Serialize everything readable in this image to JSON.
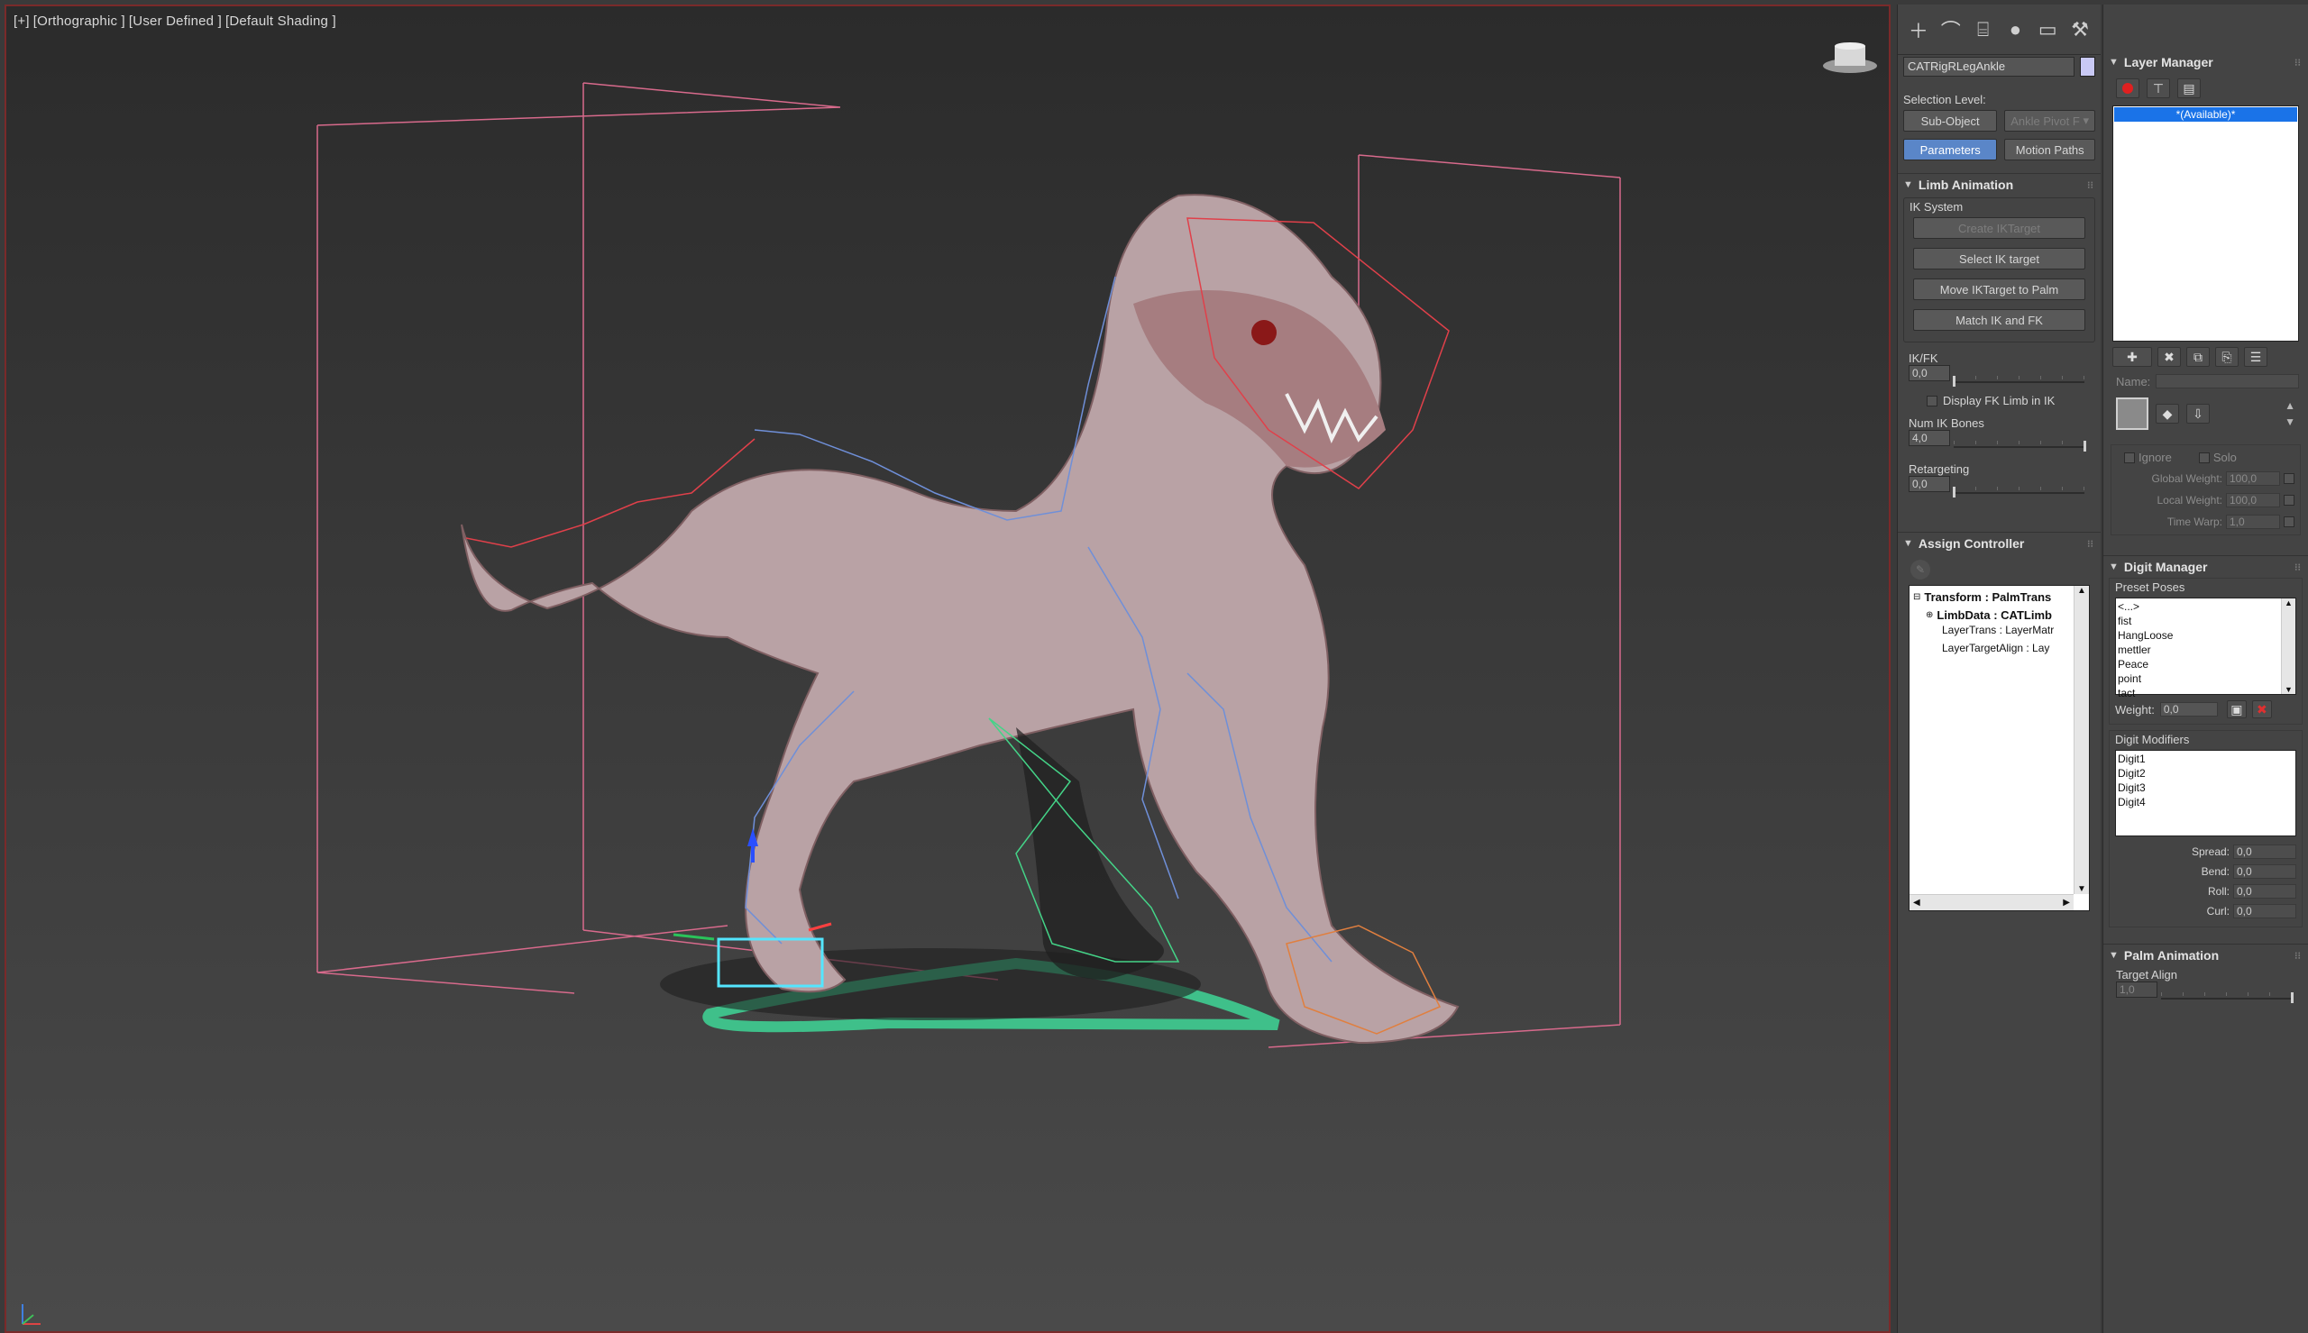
{
  "viewport": {
    "label_parts": [
      "[+]",
      "[Orthographic ]",
      "[User Defined ]",
      "[Default Shading ]"
    ]
  },
  "command_panel": {
    "tab_icons": [
      "create-icon",
      "modify-icon",
      "hierarchy-icon",
      "motion-icon",
      "display-icon",
      "utilities-icon"
    ],
    "object_name": "CATRigRLegAnkle",
    "object_color": "#c9c9f5",
    "selection_level_label": "Selection Level:",
    "sub_object_label": "Sub-Object",
    "pivot_select_value": "Ankle Pivot F",
    "parameters_label": "Parameters",
    "motion_paths_label": "Motion Paths",
    "limb_animation": {
      "title": "Limb Animation",
      "ik_system_label": "IK System",
      "create_iktarget": "Create IKTarget",
      "select_ik_target": "Select IK target",
      "move_iktarget": "Move IKTarget to Palm",
      "match_ik_fk": "Match IK and FK",
      "ikfk_label": "IK/FK",
      "ikfk_value": "0,0",
      "ikfk_fraction": 0.0,
      "display_fk_label": "Display FK Limb in IK",
      "num_ik_bones_label": "Num IK Bones",
      "num_ik_bones_value": "4,0",
      "num_ik_bones_fraction": 1.0,
      "retargeting_label": "Retargeting",
      "retargeting_value": "0,0",
      "retargeting_fraction": 0.0
    },
    "assign_controller": {
      "title": "Assign Controller",
      "tree": [
        {
          "text": "Transform : PalmTrans",
          "bold": true
        },
        {
          "text": "LimbData : CATLimb",
          "bold": true
        },
        {
          "text": "LayerTrans : LayerMatr",
          "bold": false
        },
        {
          "text": "LayerTargetAlign : Lay",
          "bold": false
        }
      ]
    }
  },
  "layer_manager": {
    "title": "Layer Manager",
    "available_item": "*(Available)*",
    "name_label": "Name:",
    "ignore_label": "Ignore",
    "solo_label": "Solo",
    "global_weight_label": "Global Weight:",
    "global_weight_value": "100,0",
    "local_weight_label": "Local Weight:",
    "local_weight_value": "100,0",
    "time_warp_label": "Time Warp:",
    "time_warp_value": "1,0"
  },
  "digit_manager": {
    "title": "Digit Manager",
    "preset_poses_label": "Preset Poses",
    "preset_poses": [
      "<...>",
      "fist",
      "HangLoose",
      "mettler",
      "Peace",
      "point",
      "tact"
    ],
    "weight_label": "Weight:",
    "weight_value": "0,0",
    "digit_modifiers_label": "Digit Modifiers",
    "digits": [
      "Digit1",
      "Digit2",
      "Digit3",
      "Digit4"
    ],
    "spread_label": "Spread:",
    "spread_value": "0,0",
    "bend_label": "Bend:",
    "bend_value": "0,0",
    "roll_label": "Roll:",
    "roll_value": "0,0",
    "curl_label": "Curl:",
    "curl_value": "0,0"
  },
  "palm_animation": {
    "title": "Palm Animation",
    "target_align_label": "Target Align",
    "target_align_value": "1,0",
    "target_align_fraction": 1.0
  }
}
